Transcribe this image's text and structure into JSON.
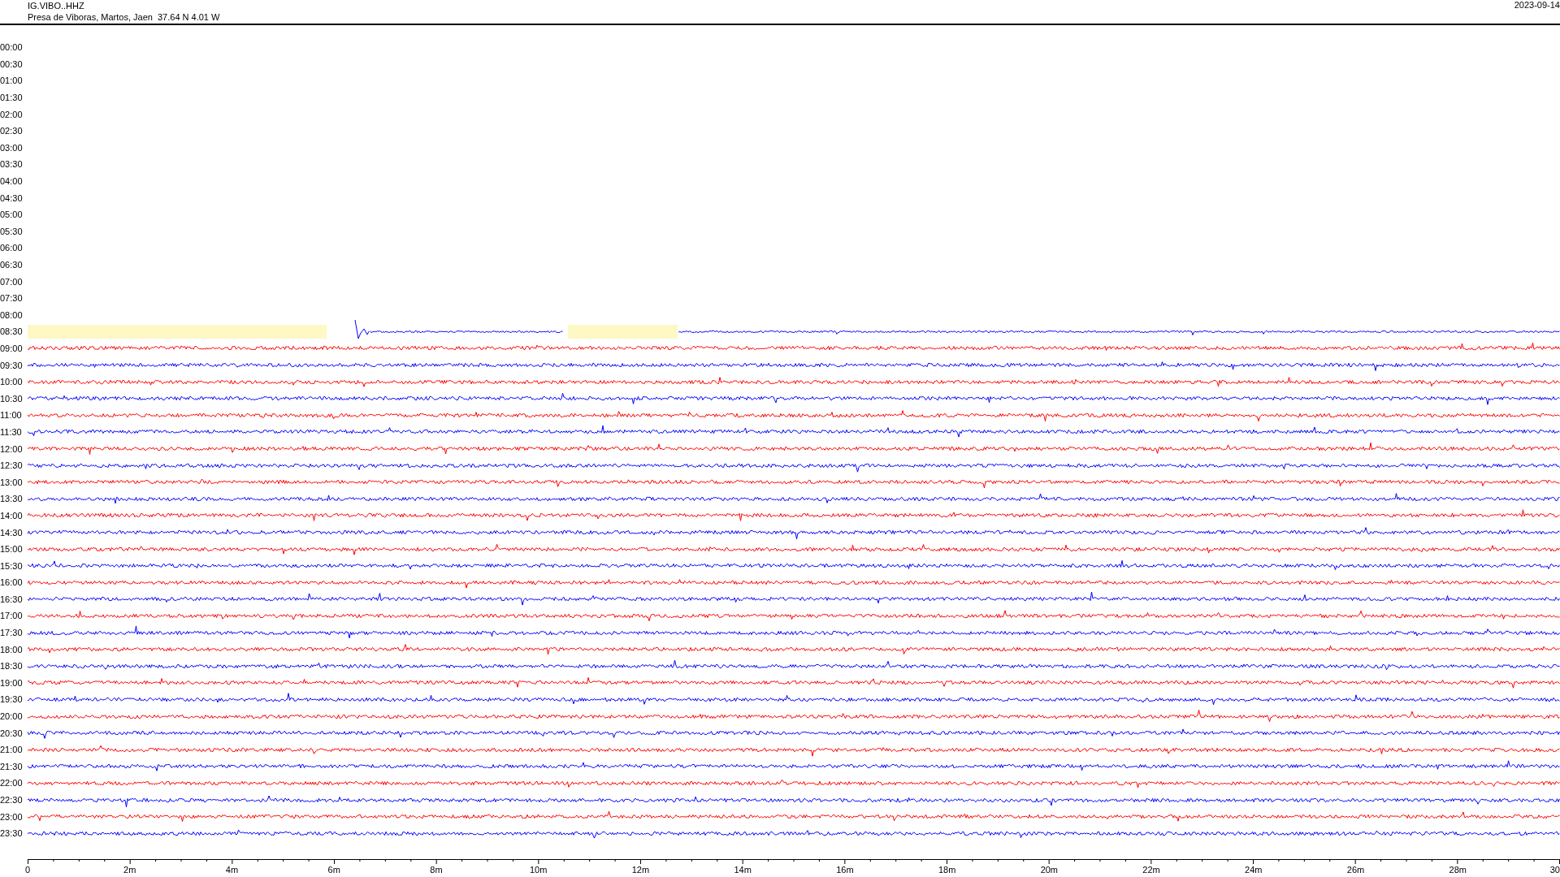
{
  "header": {
    "station": "IG.VIBO..HHZ",
    "location": "Presa de Viboras, Martos, Jaen  37.64 N 4.01 W",
    "date": "2023-09-14"
  },
  "rows": [
    {
      "label": "00:00",
      "kind": "empty"
    },
    {
      "label": "00:30",
      "kind": "empty"
    },
    {
      "label": "01:00",
      "kind": "empty"
    },
    {
      "label": "01:30",
      "kind": "empty"
    },
    {
      "label": "02:00",
      "kind": "empty"
    },
    {
      "label": "02:30",
      "kind": "empty"
    },
    {
      "label": "03:00",
      "kind": "empty"
    },
    {
      "label": "03:30",
      "kind": "empty"
    },
    {
      "label": "04:00",
      "kind": "empty"
    },
    {
      "label": "04:30",
      "kind": "empty"
    },
    {
      "label": "05:00",
      "kind": "empty"
    },
    {
      "label": "05:30",
      "kind": "empty"
    },
    {
      "label": "06:00",
      "kind": "empty"
    },
    {
      "label": "06:30",
      "kind": "empty"
    },
    {
      "label": "07:00",
      "kind": "empty"
    },
    {
      "label": "07:30",
      "kind": "empty"
    },
    {
      "label": "08:00",
      "kind": "empty"
    },
    {
      "label": "08:30",
      "kind": "partial",
      "color": "#0000ff"
    },
    {
      "label": "09:00",
      "kind": "trace",
      "color": "#ff0000"
    },
    {
      "label": "09:30",
      "kind": "trace",
      "color": "#0000ff"
    },
    {
      "label": "10:00",
      "kind": "trace",
      "color": "#ff0000"
    },
    {
      "label": "10:30",
      "kind": "trace",
      "color": "#0000ff"
    },
    {
      "label": "11:00",
      "kind": "trace",
      "color": "#ff0000"
    },
    {
      "label": "11:30",
      "kind": "trace",
      "color": "#0000ff"
    },
    {
      "label": "12:00",
      "kind": "trace",
      "color": "#ff0000"
    },
    {
      "label": "12:30",
      "kind": "trace",
      "color": "#0000ff"
    },
    {
      "label": "13:00",
      "kind": "trace",
      "color": "#ff0000"
    },
    {
      "label": "13:30",
      "kind": "trace",
      "color": "#0000ff"
    },
    {
      "label": "14:00",
      "kind": "trace",
      "color": "#ff0000"
    },
    {
      "label": "14:30",
      "kind": "trace",
      "color": "#0000ff"
    },
    {
      "label": "15:00",
      "kind": "trace",
      "color": "#ff0000"
    },
    {
      "label": "15:30",
      "kind": "trace",
      "color": "#0000ff"
    },
    {
      "label": "16:00",
      "kind": "trace",
      "color": "#ff0000"
    },
    {
      "label": "16:30",
      "kind": "trace",
      "color": "#0000ff"
    },
    {
      "label": "17:00",
      "kind": "trace",
      "color": "#ff0000"
    },
    {
      "label": "17:30",
      "kind": "trace",
      "color": "#0000ff"
    },
    {
      "label": "18:00",
      "kind": "trace",
      "color": "#ff0000"
    },
    {
      "label": "18:30",
      "kind": "trace",
      "color": "#0000ff"
    },
    {
      "label": "19:00",
      "kind": "trace",
      "color": "#ff0000"
    },
    {
      "label": "19:30",
      "kind": "trace",
      "color": "#0000ff"
    },
    {
      "label": "20:00",
      "kind": "trace",
      "color": "#ff0000"
    },
    {
      "label": "20:30",
      "kind": "trace",
      "color": "#0000ff"
    },
    {
      "label": "21:00",
      "kind": "trace",
      "color": "#ff0000"
    },
    {
      "label": "21:30",
      "kind": "trace",
      "color": "#0000ff"
    },
    {
      "label": "22:00",
      "kind": "trace",
      "color": "#ff0000"
    },
    {
      "label": "22:30",
      "kind": "trace",
      "color": "#0000ff"
    },
    {
      "label": "23:00",
      "kind": "trace",
      "color": "#ff0000"
    },
    {
      "label": "23:30",
      "kind": "trace",
      "color": "#0000ff"
    }
  ],
  "x_axis": {
    "labels": [
      "0",
      "2m",
      "4m",
      "6m",
      "8m",
      "10m",
      "12m",
      "14m",
      "16m",
      "18m",
      "20m",
      "22m",
      "24m",
      "26m",
      "28m",
      "30"
    ]
  }
}
